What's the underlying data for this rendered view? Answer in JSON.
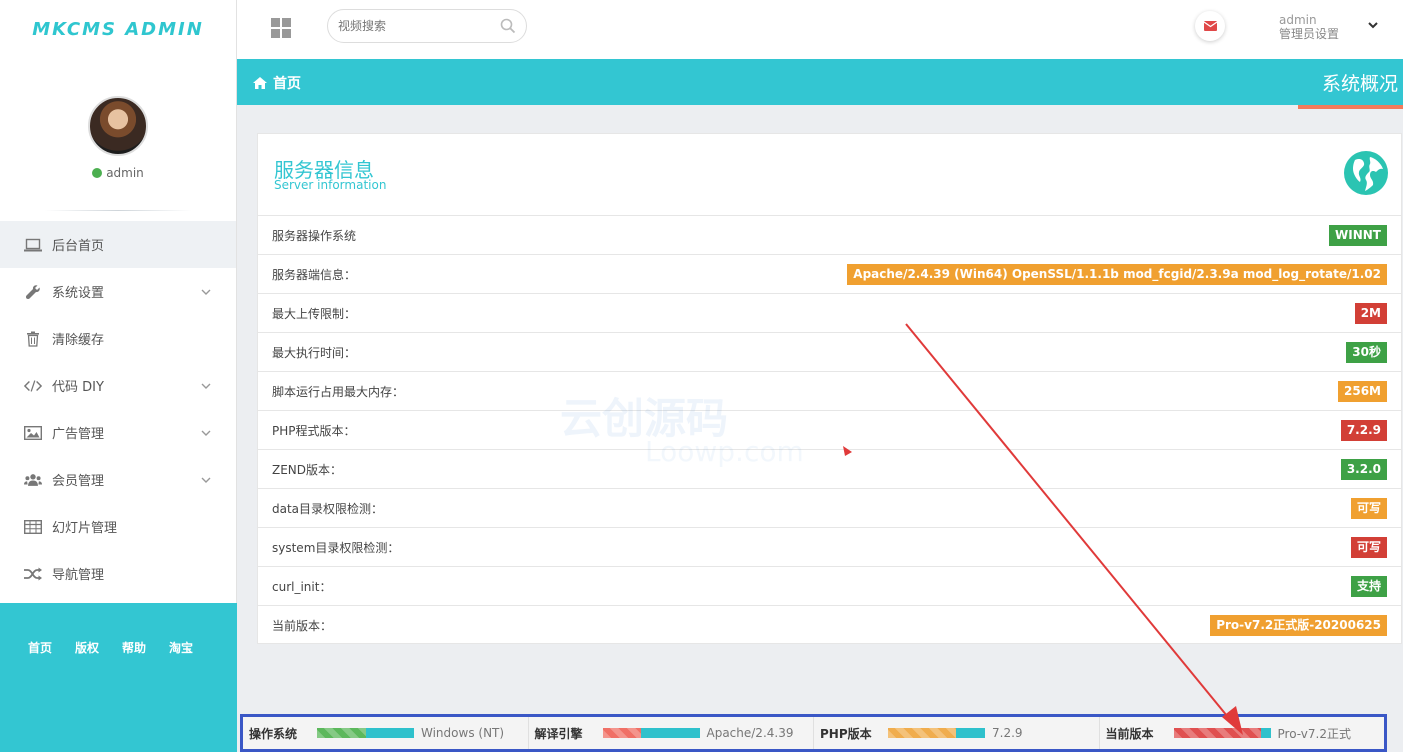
{
  "logo": "MKCMS ADMIN",
  "user": {
    "name": "admin"
  },
  "sidebar": {
    "items": [
      {
        "label": "后台首页",
        "icon": "laptop-icon",
        "active": true
      },
      {
        "label": "系统设置",
        "icon": "wrench-icon",
        "has_sub": true
      },
      {
        "label": "清除缓存",
        "icon": "trash-icon"
      },
      {
        "label": "代码 DIY",
        "icon": "code-icon",
        "has_sub": true
      },
      {
        "label": "广告管理",
        "icon": "image-icon",
        "has_sub": true
      },
      {
        "label": "会员管理",
        "icon": "users-icon",
        "has_sub": true
      },
      {
        "label": "幻灯片管理",
        "icon": "table-icon"
      },
      {
        "label": "导航管理",
        "icon": "random-icon"
      }
    ],
    "footer_links": [
      "首页",
      "版权",
      "帮助",
      "淘宝"
    ]
  },
  "topbar": {
    "search_placeholder": "视频搜索",
    "admin_name": "admin",
    "admin_role": "管理员设置"
  },
  "titlebar": {
    "crumb": "首页",
    "page_title": "系统概况"
  },
  "panel": {
    "title": "服务器信息",
    "subtitle": "Server information",
    "rows": [
      {
        "label": "服务器操作系统",
        "value": "WINNT",
        "color": "#3ea146"
      },
      {
        "label": "服务器端信息：",
        "value": "Apache/2.4.39 (Win64) OpenSSL/1.1.1b mod_fcgid/2.3.9a mod_log_rotate/1.02",
        "color": "#f0a030"
      },
      {
        "label": "最大上传限制：",
        "value": "2M",
        "color": "#d23f36"
      },
      {
        "label": "最大执行时间：",
        "value": "30秒",
        "color": "#3ea146"
      },
      {
        "label": "脚本运行占用最大内存：",
        "value": "256M",
        "color": "#f0a030"
      },
      {
        "label": "PHP程式版本：",
        "value": "7.2.9",
        "color": "#d23f36"
      },
      {
        "label": "ZEND版本：",
        "value": "3.2.0",
        "color": "#3ea146"
      },
      {
        "label": "data目录权限检测：",
        "value": "可写",
        "color": "#f0a030"
      },
      {
        "label": "system目录权限检测：",
        "value": "可写",
        "color": "#d23f36"
      },
      {
        "label": "curl_init：",
        "value": "支持",
        "color": "#3ea146"
      },
      {
        "label": "当前版本：",
        "value": "Pro-v7.2正式版-20200625",
        "color": "#f0a030"
      }
    ]
  },
  "watermark": {
    "line1": "云创源码",
    "line2": "Loowp.com"
  },
  "status": [
    {
      "label": "操作系统",
      "value": "Windows (NT)",
      "fill_color": "#5cb85c",
      "fill": 0.5
    },
    {
      "label": "解译引擎",
      "value": "Apache/2.4.39",
      "fill_color": "#f07066",
      "fill": 0.4
    },
    {
      "label": "PHP版本",
      "value": "7.2.9",
      "fill_color": "#f0ad4e",
      "fill": 0.7
    },
    {
      "label": "当前版本",
      "value": "Pro-v7.2正式",
      "fill_color": "#e05050",
      "fill": 0.9
    }
  ],
  "colors": {
    "accent": "#33c6d2",
    "highlight_border": "#3a57c6",
    "underline": "#f37b5b"
  }
}
